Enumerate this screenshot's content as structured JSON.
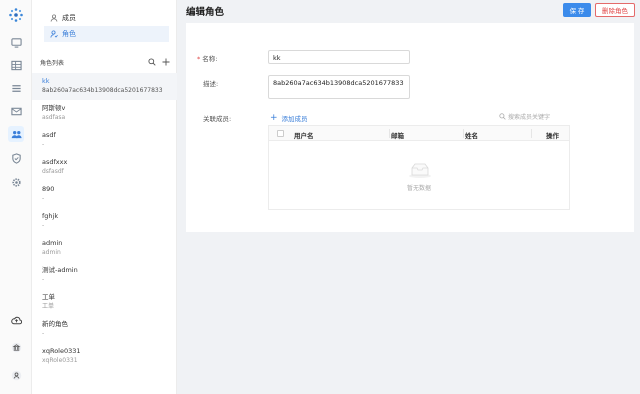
{
  "sidebar_nav": {
    "members_label": "成员",
    "roles_label": "角色"
  },
  "role_list": {
    "header": "角色列表",
    "items": [
      {
        "name": "kk",
        "desc": "8ab260a7ac634b13908dca5201677833"
      },
      {
        "name": "阿斯顿v",
        "desc": "asdfasa"
      },
      {
        "name": "asdf",
        "desc": "-"
      },
      {
        "name": "asdfxxx",
        "desc": "dsfasdf"
      },
      {
        "name": "890",
        "desc": "-"
      },
      {
        "name": "fghjk",
        "desc": "-"
      },
      {
        "name": "admin",
        "desc": "admin"
      },
      {
        "name": "测试-admin",
        "desc": "-"
      },
      {
        "name": "工单",
        "desc": "工单"
      },
      {
        "name": "新的角色",
        "desc": "-"
      },
      {
        "name": "xqRole0331",
        "desc": "xqRole0331"
      }
    ]
  },
  "header": {
    "title": "编辑角色",
    "save_label": "保 存",
    "delete_label": "删除角色"
  },
  "form": {
    "name_label": "名称:",
    "name_value": "kk",
    "desc_label": "描述:",
    "desc_value": "8ab260a7ac634b13908dca5201677833",
    "members_label": "关联成员:",
    "add_member_label": "添加成员",
    "search_placeholder": "搜索成员关键字"
  },
  "members_table": {
    "columns": [
      "用户名",
      "邮箱",
      "姓名",
      "操作"
    ],
    "empty_text": "暂无数据"
  },
  "colors": {
    "accent": "#3b8beb",
    "danger": "#e04545"
  }
}
